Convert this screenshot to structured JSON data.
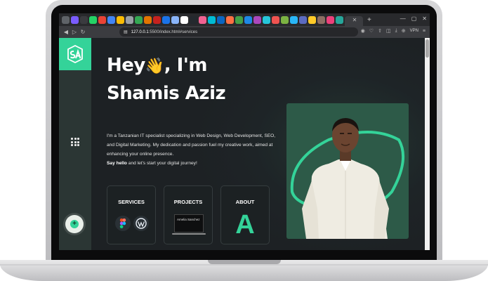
{
  "browser": {
    "url_host": "127.0.0.1",
    "url_path": ":5500/index.html#services",
    "vpn_label": "VPN",
    "tab_close": "✕",
    "tab_plus": "+",
    "nav": {
      "back": "◀",
      "forward": "▷",
      "reload": "↻"
    }
  },
  "hero": {
    "greeting": "Hey",
    "wave": "👋",
    "greeting_suffix": ", I'm",
    "name": "Shamis Aziz",
    "intro": "I'm a Tanzanian IT specialist specializing in Web Design, Web Development, SEO, and Digital Marketing. My dedication and passion fuel my creative work, aimed at enhancing your online presence.",
    "cta_bold": "Say hello",
    "cta_rest": " and let's start your digital journey!"
  },
  "cards": {
    "services_title": "SERVICES",
    "projects_title": "PROJECTS",
    "project_thumb_text": "Amelia Sanchez",
    "about_title": "ABOUT",
    "about_letter": "A"
  },
  "colors": {
    "accent": "#34d399",
    "background": "#1d2124",
    "sidebar": "#2b3634"
  },
  "icons": {
    "logo": "sa-logo",
    "menu": "grid-menu-icon",
    "fab": "plus-icon",
    "services": [
      "figma-icon",
      "wordpress-icon"
    ]
  }
}
